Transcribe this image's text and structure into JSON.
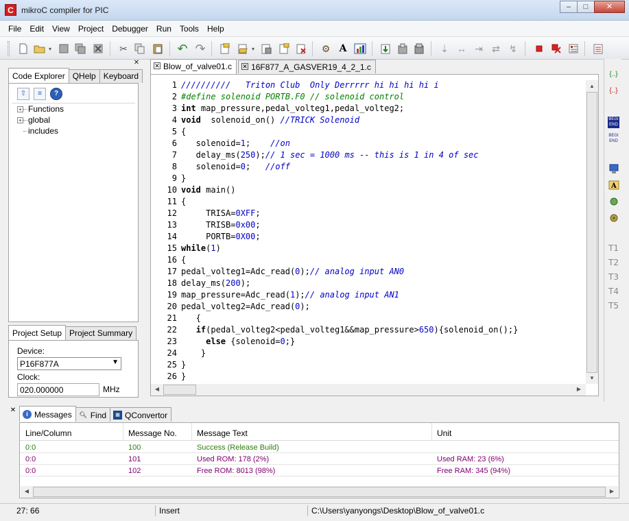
{
  "window": {
    "title": "mikroC compiler for PIC",
    "app_icon": "C",
    "minimize": "–",
    "maximize": "□",
    "close": "✕"
  },
  "menu": [
    "File",
    "Edit",
    "View",
    "Project",
    "Debugger",
    "Run",
    "Tools",
    "Help"
  ],
  "left_panel": {
    "close": "✕",
    "tabs": [
      "Code Explorer",
      "QHelp",
      "Keyboard"
    ],
    "tree": [
      "Functions",
      "global",
      "includes"
    ],
    "project_tabs": [
      "Project Setup",
      "Project Summary"
    ],
    "device_label": "Device:",
    "device_value": "P16F877A",
    "clock_label": "Clock:",
    "clock_value": "020.000000",
    "clock_unit": "MHz"
  },
  "editor": {
    "tabs": [
      "Blow_of_valve01.c",
      "16F877_A_GASVER19_4_2_1.c"
    ],
    "lines": [
      [
        [
          "cm",
          "//////////   Triton Club  Only Derrrrr hi hi hi hi i"
        ]
      ],
      [
        [
          "pp",
          "#define solenoid PORTB.F0 // solenoid control"
        ]
      ],
      [
        [
          "kw",
          "int"
        ],
        [
          "",
          " map_pressure,pedal_volteg1,pedal_volteg2;"
        ]
      ],
      [
        [
          "kw",
          "void"
        ],
        [
          "",
          "  solenoid_on() "
        ],
        [
          "cm",
          "//TRICK Solenoid"
        ]
      ],
      [
        [
          "",
          "{"
        ]
      ],
      [
        [
          "",
          "   solenoid="
        ],
        [
          "num",
          "1"
        ],
        [
          "",
          ";    "
        ],
        [
          "cm",
          "//on"
        ]
      ],
      [
        [
          "",
          "   delay_ms("
        ],
        [
          "num",
          "250"
        ],
        [
          "",
          ");"
        ],
        [
          "cm",
          "// 1 sec = 1000 ms -- this is 1 in 4 of sec"
        ]
      ],
      [
        [
          "",
          "   solenoid="
        ],
        [
          "num",
          "0"
        ],
        [
          "",
          ";   "
        ],
        [
          "cm",
          "//off"
        ]
      ],
      [
        [
          "",
          "}"
        ]
      ],
      [
        [
          "kw",
          "void"
        ],
        [
          "",
          " main()"
        ]
      ],
      [
        [
          "",
          "{"
        ]
      ],
      [
        [
          "",
          "     TRISA="
        ],
        [
          "num",
          "0XFF"
        ],
        [
          "",
          ";"
        ]
      ],
      [
        [
          "",
          "     TRISB="
        ],
        [
          "num",
          "0x00"
        ],
        [
          "",
          ";"
        ]
      ],
      [
        [
          "",
          "     PORTB="
        ],
        [
          "num",
          "0X00"
        ],
        [
          "",
          ";"
        ]
      ],
      [
        [
          "kw",
          "while"
        ],
        [
          "",
          "("
        ],
        [
          "num",
          "1"
        ],
        [
          "",
          ")"
        ]
      ],
      [
        [
          "",
          "{"
        ]
      ],
      [
        [
          "",
          "pedal_volteg1=Adc_read("
        ],
        [
          "num",
          "0"
        ],
        [
          "",
          ");"
        ],
        [
          "cm",
          "// analog input AN0"
        ]
      ],
      [
        [
          "",
          "delay_ms("
        ],
        [
          "num",
          "200"
        ],
        [
          "",
          ");"
        ]
      ],
      [
        [
          "",
          "map_pressure=Adc_read("
        ],
        [
          "num",
          "1"
        ],
        [
          "",
          ");"
        ],
        [
          "cm",
          "// analog input AN1"
        ]
      ],
      [
        [
          "",
          "pedal_volteg2=Adc_read("
        ],
        [
          "num",
          "0"
        ],
        [
          "",
          ");"
        ]
      ],
      [
        [
          "",
          "   {"
        ]
      ],
      [
        [
          "",
          "   "
        ],
        [
          "kw",
          "if"
        ],
        [
          "",
          "(pedal_volteg2<pedal_volteg1&&map_pressure>"
        ],
        [
          "num",
          "650"
        ],
        [
          "",
          "){solenoid_on();}"
        ]
      ],
      [
        [
          "",
          "     "
        ],
        [
          "kw",
          "else"
        ],
        [
          "",
          " {solenoid="
        ],
        [
          "num",
          "0"
        ],
        [
          "",
          ";}"
        ]
      ],
      [
        [
          "",
          "    }"
        ]
      ],
      [
        [
          "",
          "}"
        ]
      ],
      [
        [
          "",
          "}"
        ]
      ]
    ]
  },
  "right_dock": [
    "T1",
    "T2",
    "T3",
    "T4",
    "T5"
  ],
  "messages": {
    "close": "✕",
    "tabs": [
      "Messages",
      "Find",
      "QConvertor"
    ],
    "columns": [
      "Line/Column",
      "Message No.",
      "Message Text",
      "Unit"
    ],
    "rows": [
      {
        "line": "0:0",
        "no": "100",
        "text": "Success (Release Build)",
        "unit": "",
        "color": "green"
      },
      {
        "line": "0:0",
        "no": "101",
        "text": "Used ROM: 178  (2%)",
        "unit": "Used RAM: 23  (6%)",
        "color": "purple"
      },
      {
        "line": "0:0",
        "no": "102",
        "text": "Free ROM: 8013  (98%)",
        "unit": "Free RAM: 345  (94%)",
        "color": "purple"
      }
    ]
  },
  "status": {
    "position": "27: 66",
    "mode": "Insert",
    "path": "C:\\Users\\yanyongs\\Desktop\\Blow_of_valve01.c"
  }
}
